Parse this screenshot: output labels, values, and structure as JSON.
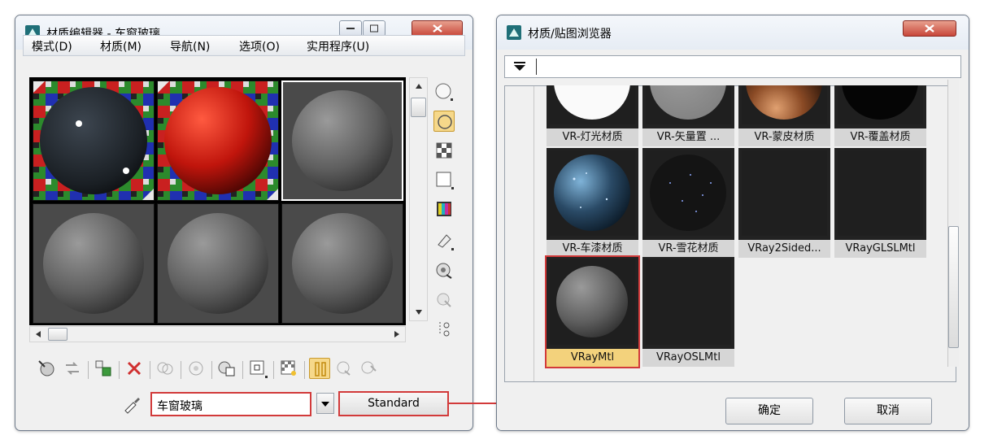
{
  "editor": {
    "title": "材质编辑器 - 车窗玻璃",
    "menu": [
      "模式(D)",
      "材质(M)",
      "导航(N)",
      "选项(O)",
      "实用程序(U)"
    ],
    "material_name": "车窗玻璃",
    "material_type": "Standard"
  },
  "browser": {
    "title": "材质/贴图浏览器",
    "search_value": "",
    "items": [
      "VR-灯光材质",
      "VR-矢量置 ...",
      "VR-蒙皮材质",
      "VR-覆盖材质",
      "VR-车漆材质",
      "VR-雪花材质",
      "VRay2Sided...",
      "VRayGLSLMtl",
      "VRayMtl",
      "VRayOSLMtl"
    ],
    "selected_item": "VRayMtl",
    "ok_label": "确定",
    "cancel_label": "取消"
  },
  "colors": {
    "highlight": "#d23a3a",
    "selected_label_bg": "#f3d27c"
  }
}
